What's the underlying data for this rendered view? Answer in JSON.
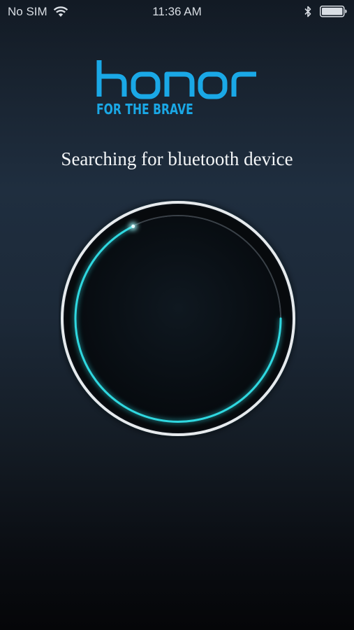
{
  "status_bar": {
    "carrier": "No SIM",
    "time": "11:36 AM",
    "icons": [
      "wifi-icon",
      "bluetooth-icon",
      "battery-icon"
    ]
  },
  "logo": {
    "wordmark": "honor",
    "tagline": "FOR THE BRAVE",
    "color": "#1aa8e6"
  },
  "status_message": "Searching for bluetooth device",
  "scanner": {
    "accent_color": "#2fd8e0",
    "ring_color": "#e8ecef",
    "state": "searching"
  }
}
